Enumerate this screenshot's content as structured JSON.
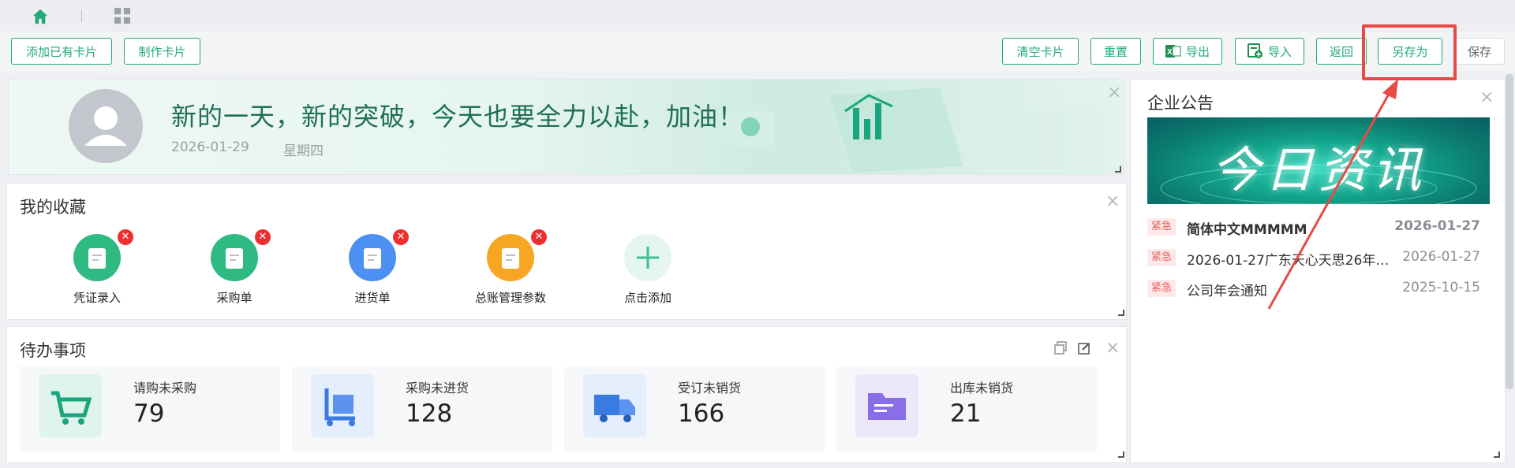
{
  "topbar": {
    "home_icon": "home-icon",
    "grid_icon": "apps-grid-icon"
  },
  "toolbar": {
    "add_existing_card": "添加已有卡片",
    "make_card": "制作卡片",
    "clear_cards": "清空卡片",
    "reset": "重置",
    "export": "导出",
    "import": "导入",
    "back": "返回",
    "save_as": "另存为",
    "save": "保存"
  },
  "banner": {
    "greeting": "新的一天，新的突破，今天也要全力以赴，加油！",
    "date": "2026-01-29",
    "weekday": "星期四"
  },
  "favorites": {
    "title": "我的收藏",
    "items": [
      {
        "label": "凭证录入",
        "color": "#2fb983"
      },
      {
        "label": "采购单",
        "color": "#2fb983"
      },
      {
        "label": "进货单",
        "color": "#4b90f2"
      },
      {
        "label": "总账管理参数",
        "color": "#f6a623"
      },
      {
        "label": "点击添加",
        "color": "#e5f6ef"
      }
    ]
  },
  "todo": {
    "title": "待办事项",
    "items": [
      {
        "label": "请购未采购",
        "count": "79"
      },
      {
        "label": "采购未进货",
        "count": "128"
      },
      {
        "label": "受订未销货",
        "count": "166"
      },
      {
        "label": "出库未销货",
        "count": "21"
      }
    ]
  },
  "notice": {
    "title": "企业公告",
    "image_text": "今日资讯",
    "items": [
      {
        "tag": "紧急",
        "text": "简体中文MMMMM",
        "date": "2026-01-27"
      },
      {
        "tag": "紧急",
        "text": "2026-01-27广东天心天思26年…",
        "date": "2026-01-27"
      },
      {
        "tag": "紧急",
        "text": "公司年会通知",
        "date": "2025-10-15"
      }
    ]
  },
  "colors": {
    "accent": "#21a97a",
    "highlight": "#e64b47"
  }
}
